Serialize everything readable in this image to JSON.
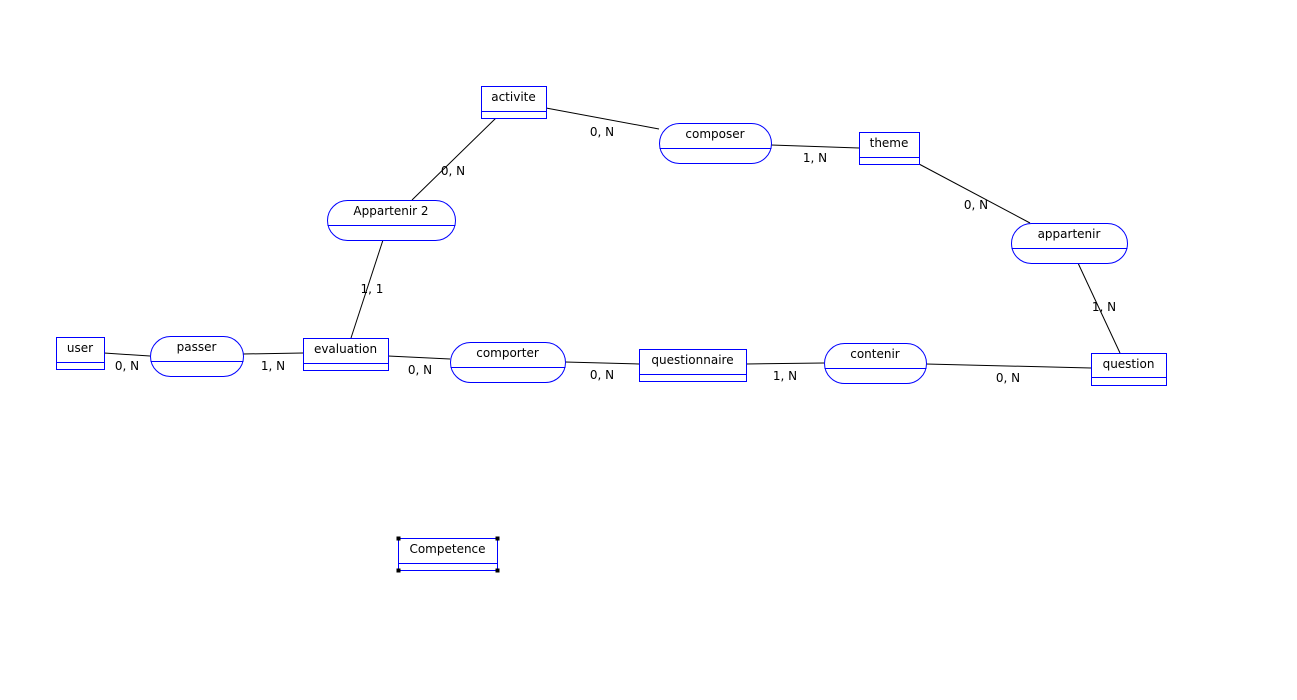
{
  "diagram": {
    "colors": {
      "shape_stroke": "#0000ff",
      "link": "#000000",
      "background": "#ffffff"
    },
    "entities": [
      {
        "id": "user",
        "label": "user"
      },
      {
        "id": "evaluation",
        "label": "evaluation"
      },
      {
        "id": "activite",
        "label": "activite"
      },
      {
        "id": "theme",
        "label": "theme"
      },
      {
        "id": "questionnaire",
        "label": "questionnaire"
      },
      {
        "id": "question",
        "label": "question"
      },
      {
        "id": "competence",
        "label": "Competence",
        "selected": true
      }
    ],
    "associations": [
      {
        "id": "passer",
        "label": "passer"
      },
      {
        "id": "appartenir2",
        "label": "Appartenir 2"
      },
      {
        "id": "composer",
        "label": "composer"
      },
      {
        "id": "appartenir",
        "label": "appartenir"
      },
      {
        "id": "comporter",
        "label": "comporter"
      },
      {
        "id": "contenir",
        "label": "contenir"
      }
    ],
    "links": [
      {
        "from": "user",
        "to": "passer",
        "cardinality": "0, N"
      },
      {
        "from": "evaluation",
        "to": "passer",
        "cardinality": "1, N"
      },
      {
        "from": "evaluation",
        "to": "comporter",
        "cardinality": "0, N"
      },
      {
        "from": "questionnaire",
        "to": "comporter",
        "cardinality": "0, N"
      },
      {
        "from": "questionnaire",
        "to": "contenir",
        "cardinality": "1, N"
      },
      {
        "from": "question",
        "to": "contenir",
        "cardinality": "0, N"
      },
      {
        "from": "question",
        "to": "appartenir",
        "cardinality": "1, N"
      },
      {
        "from": "theme",
        "to": "appartenir",
        "cardinality": "0, N"
      },
      {
        "from": "theme",
        "to": "composer",
        "cardinality": "1, N"
      },
      {
        "from": "activite",
        "to": "composer",
        "cardinality": "0, N"
      },
      {
        "from": "activite",
        "to": "appartenir2",
        "cardinality": "0, N"
      },
      {
        "from": "evaluation",
        "to": "appartenir2",
        "cardinality": "1, 1"
      }
    ]
  }
}
